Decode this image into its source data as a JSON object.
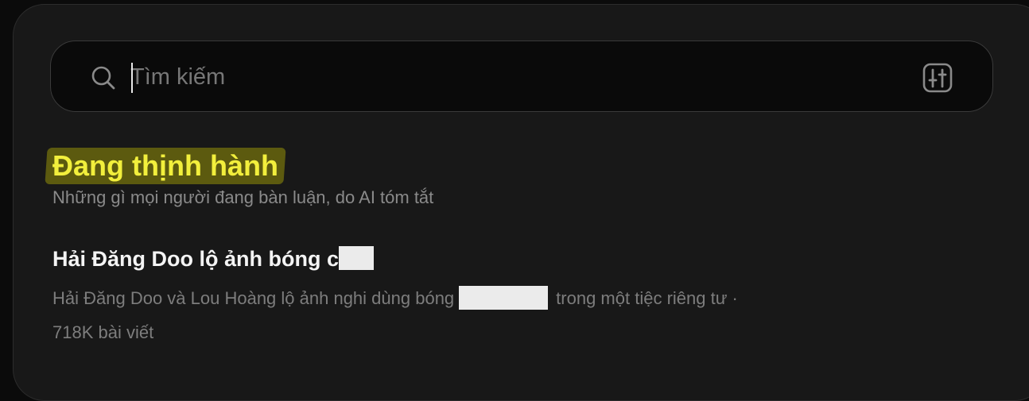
{
  "search": {
    "placeholder": "Tìm kiếm",
    "value": "",
    "icon": "search-icon",
    "filter_icon": "sliders-icon"
  },
  "trending": {
    "title": "Đang thịnh hành",
    "subtitle": "Những gì mọi người đang bàn luận, do AI tóm tắt",
    "highlight_color": "#5c5a0f",
    "title_color": "#f2ef3c"
  },
  "topics": [
    {
      "title_prefix": "Hải Đăng Doo lộ ảnh bóng c",
      "desc_before": "Hải Đăng Doo và Lou Hoàng lộ ảnh nghi dùng bóng",
      "desc_after": "trong một tiệc riêng tư ·",
      "post_count": "718K bài viết"
    }
  ]
}
